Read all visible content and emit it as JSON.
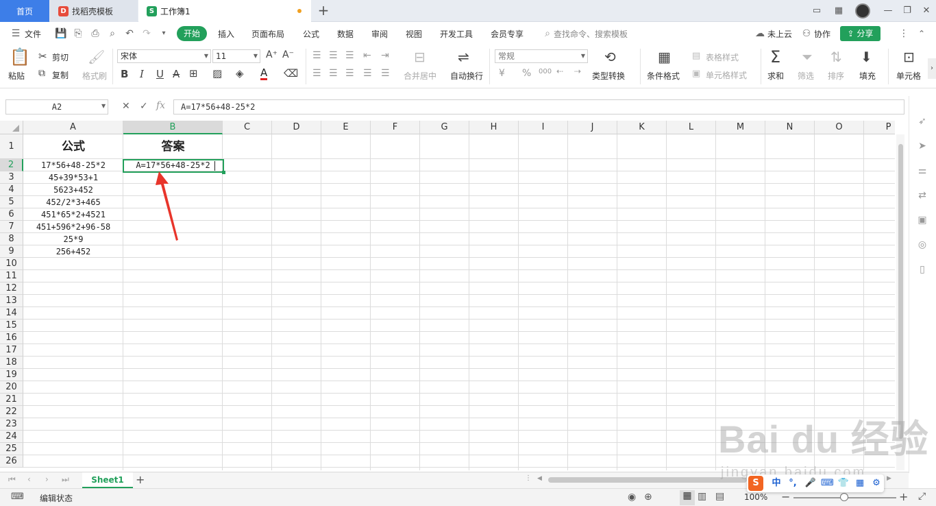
{
  "tabs": {
    "home": "首页",
    "template": "找稻壳模板",
    "document": "工作簿1",
    "template_logo": "D",
    "document_logo": "S"
  },
  "menu": {
    "file": "文件",
    "items": [
      "开始",
      "插入",
      "页面布局",
      "公式",
      "数据",
      "审阅",
      "视图",
      "开发工具",
      "会员专享"
    ],
    "search": "查找命令、搜索模板",
    "cloud": "未上云",
    "collab": "协作",
    "share": "分享"
  },
  "ribbon": {
    "paste": "粘贴",
    "cut": "剪切",
    "copy": "复制",
    "format_painter": "格式刷",
    "font_name": "宋体",
    "font_size": "11",
    "merge_center": "合并居中",
    "wrap": "自动换行",
    "number_format": "常规",
    "type_convert": "类型转换",
    "cond_format": "条件格式",
    "table_style": "表格样式",
    "cell_style": "单元格样式",
    "sum": "求和",
    "filter": "筛选",
    "sort": "排序",
    "fill": "填充",
    "cell": "单元格",
    "percent": "%",
    "thousands": "000",
    "bold": "B",
    "italic": "I",
    "underline": "U",
    "font_color_glyph": "A",
    "accent_color": "#22a05b"
  },
  "formula_bar": {
    "name_box": "A2",
    "fx": "fx",
    "content": "A=17*56+48-25*2"
  },
  "columns": [
    "A",
    "B",
    "C",
    "D",
    "E",
    "F",
    "G",
    "H",
    "I",
    "J",
    "K",
    "L",
    "M",
    "N",
    "O",
    "P"
  ],
  "rows": [
    "1",
    "2",
    "3",
    "4",
    "5",
    "6",
    "7",
    "8",
    "9",
    "10",
    "11",
    "12",
    "13",
    "14",
    "15",
    "16",
    "17",
    "18",
    "19",
    "20",
    "21",
    "22",
    "23",
    "24",
    "25",
    "26"
  ],
  "cells": {
    "A1": "公式",
    "B1": "答案",
    "A2": "17*56+48-25*2",
    "A3": "45+39*53+1",
    "A4": "5623+452",
    "A5": "452/2*3+465",
    "A6": "451*65*2+4521",
    "A7": "451+596*2+96-58",
    "A8": "25*9",
    "A9": "256+452",
    "B2": "A=17*56+48-25*2"
  },
  "sheets": {
    "active": "Sheet1"
  },
  "status": {
    "mode": "编辑状态",
    "zoom": "100%"
  },
  "watermark": {
    "main": "Bai du 经验",
    "sub": "jingyan.baidu.com"
  },
  "ime": {
    "logo": "S",
    "lang": "中"
  }
}
